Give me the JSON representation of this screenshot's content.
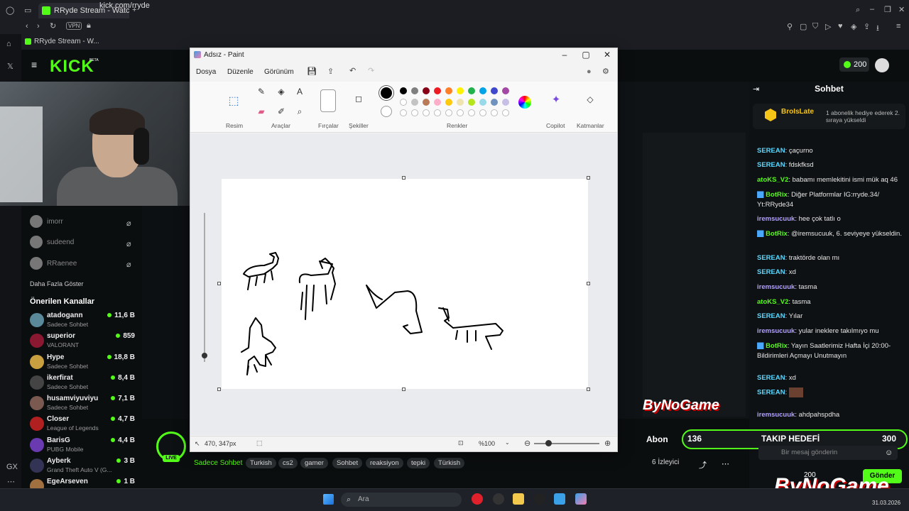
{
  "browser": {
    "tab_title": "RRyde Stream - Watch Liv",
    "url": "kick.com/rryde",
    "vpn": "VPN",
    "bookmark": "RRyde Stream - W..."
  },
  "kick": {
    "logo": "KICK",
    "logo_badge": "BETA",
    "coins": "200"
  },
  "sidebar": {
    "recent": [
      "imorr",
      "sudeend",
      "RRaenee"
    ],
    "show_more": "Daha Fazla Göster",
    "heading": "Önerilen Kanallar",
    "channels": [
      {
        "name": "atadogann",
        "sub": "Sadece Sohbet",
        "viewers": "11,6 B",
        "color": "#5a8a9a"
      },
      {
        "name": "superior",
        "sub": "VALORANT",
        "viewers": "859",
        "color": "#8a1830"
      },
      {
        "name": "Hype",
        "sub": "Sadece Sohbet",
        "viewers": "18,8 B",
        "color": "#c8a040"
      },
      {
        "name": "ikerfirat",
        "sub": "Sadece Sohbet",
        "viewers": "8,4 B",
        "color": "#444"
      },
      {
        "name": "husamviyuviyu",
        "sub": "Sadece Sohbet",
        "viewers": "7,1 B",
        "color": "#7a5a50"
      },
      {
        "name": "Closer",
        "sub": "League of Legends",
        "viewers": "4,7 B",
        "color": "#b02020"
      },
      {
        "name": "BarisG",
        "sub": "PUBG Mobile",
        "viewers": "4,4 B",
        "color": "#6a3ab0"
      },
      {
        "name": "Ayberk",
        "sub": "Grand Theft Auto V (G...",
        "viewers": "3 B",
        "color": "#335"
      },
      {
        "name": "EgeArseven",
        "sub": "",
        "viewers": "1 B",
        "color": "#a07040"
      }
    ]
  },
  "stream": {
    "category": "Sadece Sohbet",
    "tags": [
      "Turkish",
      "cs2",
      "gamer",
      "Sohbet",
      "reaksiyon",
      "tepki",
      "Türkish"
    ],
    "live_label": "LIVE"
  },
  "chat": {
    "title": "Sohbet",
    "pinned_user": "BroIsLate",
    "pinned_text": "1 abonelik hediye ederek 2. sıraya yükseldi",
    "messages": [
      {
        "user": "SEREAN",
        "color": "#5ad8ff",
        "text": "çaçurno"
      },
      {
        "user": "SEREAN",
        "color": "#5ad8ff",
        "text": "fdskfksd"
      },
      {
        "user": "atoKS_V2",
        "color": "#53fc18",
        "text": "babamı memlekitini ismi mük aq 46"
      },
      {
        "user": "BotRix",
        "color": "#53fc18",
        "text": "Diğer Platformlar IG:rryde.34/ Yt:RRyde34"
      },
      {
        "user": "iremsucuuk",
        "color": "#b0a0ff",
        "text": "hee çok tatlı o"
      },
      {
        "user": "BotRix",
        "color": "#53fc18",
        "text": "@iremsucuuk, 6. seviyeye yükseldin."
      },
      {
        "user": "SEREAN",
        "color": "#5ad8ff",
        "text": "traktörde olan mı"
      },
      {
        "user": "SEREAN",
        "color": "#5ad8ff",
        "text": "xd"
      },
      {
        "user": "iremsucuuk",
        "color": "#b0a0ff",
        "text": "tasma"
      },
      {
        "user": "atoKS_V2",
        "color": "#53fc18",
        "text": "tasma"
      },
      {
        "user": "SEREAN",
        "color": "#5ad8ff",
        "text": "Yılar"
      },
      {
        "user": "iremsucuuk",
        "color": "#b0a0ff",
        "text": "yular ineklere takılmıyo mu"
      },
      {
        "user": "BotRix",
        "color": "#53fc18",
        "text": "Yayın Saatlerimiz Hafta İçi 20:00-Bildirimleri Açmayı Unutmayın"
      },
      {
        "user": "SEREAN",
        "color": "#5ad8ff",
        "text": "xd"
      },
      {
        "user": "SEREAN",
        "color": "#5ad8ff",
        "text": ""
      },
      {
        "user": "iremsucuuk",
        "color": "#b0a0ff",
        "text": "ahdpahspdha"
      }
    ],
    "goal_left": "136",
    "goal_title": "TAKIP HEDEFİ",
    "goal_right": "300",
    "input_placeholder": "Bir mesaj gönderin",
    "abone": "Abon",
    "viewers": "6 İzleyici",
    "coins": "200",
    "send": "Gönder",
    "sponsor": "ByNoGame"
  },
  "paint": {
    "title": "Adsız - Paint",
    "menus": [
      "Dosya",
      "Düzenle",
      "Görünüm"
    ],
    "groups": [
      "Resim",
      "Araçlar",
      "Fırçalar",
      "Şekiller",
      "Renkler",
      "Copilot",
      "Katmanlar"
    ],
    "palette_row1": [
      "#000000",
      "#7f7f7f",
      "#880015",
      "#ed1c24",
      "#ff7f27",
      "#fff200",
      "#22b14c",
      "#00a2e8",
      "#3f48cc",
      "#a349a4"
    ],
    "palette_row2": [
      "#ffffff",
      "#c3c3c3",
      "#b97a57",
      "#ffaec9",
      "#ffc90e",
      "#efe4b0",
      "#b5e61d",
      "#99d9ea",
      "#7092be",
      "#c8bfe7"
    ],
    "coords": "470, 347px",
    "zoom": "%100"
  },
  "taskbar": {
    "search": "Ara",
    "time": "31.03.2026"
  }
}
